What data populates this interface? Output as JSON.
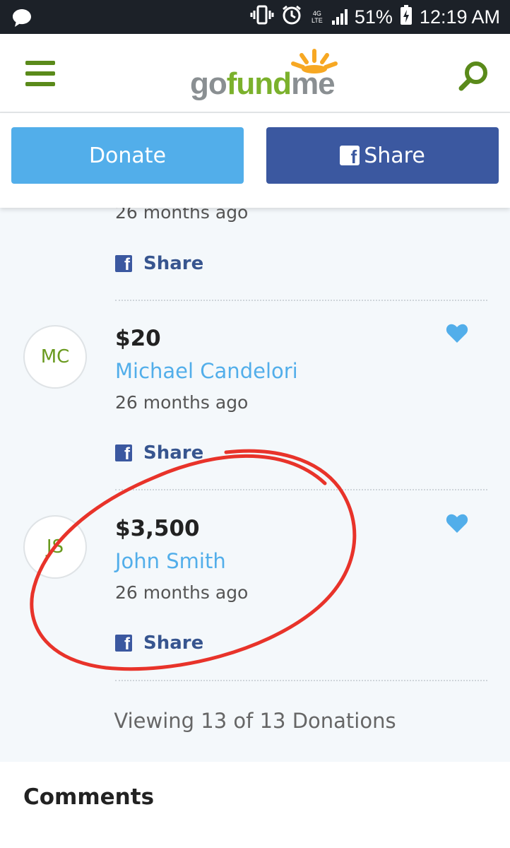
{
  "status_bar": {
    "battery": "51%",
    "time": "12:19 AM",
    "network": "4G LTE"
  },
  "header": {
    "logo": {
      "go": "go",
      "fund": "fund",
      "me": "me"
    }
  },
  "actions": {
    "donate_label": "Donate",
    "share_label": "Share"
  },
  "donations": {
    "partial_time": "26 months ago",
    "share_label": "Share",
    "items": [
      {
        "initials": "MC",
        "amount": "$20",
        "name": "Michael Candelori",
        "time": "26 months ago",
        "share_label": "Share"
      },
      {
        "initials": "JS",
        "amount": "$3,500",
        "name": "John Smith",
        "time": "26 months ago",
        "share_label": "Share"
      }
    ],
    "viewing_text": "Viewing 13 of 13 Donations"
  },
  "comments": {
    "title": "Comments"
  },
  "colors": {
    "brand_green": "#6a9a1f",
    "donate_blue": "#52aeea",
    "facebook_blue": "#3b58a0",
    "annotation_red": "#e8332a"
  }
}
